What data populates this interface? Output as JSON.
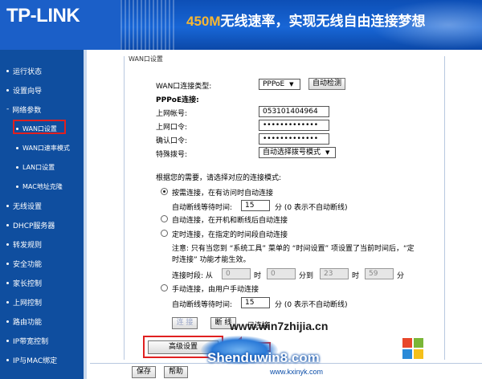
{
  "header": {
    "logo": "TP-LINK",
    "slogan_highlight": "450M",
    "slogan_rest": "无线速率，实现无线自由连接梦想"
  },
  "sidebar": {
    "items": [
      {
        "label": "运行状态",
        "level": "top"
      },
      {
        "label": "设置向导",
        "level": "top"
      },
      {
        "label": "网络参数",
        "level": "group"
      },
      {
        "label": "WAN口设置",
        "level": "sub",
        "selected": true
      },
      {
        "label": "WAN口速率模式",
        "level": "sub"
      },
      {
        "label": "LAN口设置",
        "level": "sub"
      },
      {
        "label": "MAC地址克隆",
        "level": "sub"
      },
      {
        "label": "无线设置",
        "level": "top"
      },
      {
        "label": "DHCP服务器",
        "level": "top"
      },
      {
        "label": "转发规则",
        "level": "top"
      },
      {
        "label": "安全功能",
        "level": "top"
      },
      {
        "label": "家长控制",
        "level": "top"
      },
      {
        "label": "上网控制",
        "level": "top"
      },
      {
        "label": "路由功能",
        "level": "top"
      },
      {
        "label": "IP带宽控制",
        "level": "top"
      },
      {
        "label": "IP与MAC绑定",
        "level": "top"
      }
    ]
  },
  "form": {
    "title": "WAN口设置",
    "conn_type_label": "WAN口连接类型:",
    "conn_type_value": "PPPoE",
    "auto_detect": "自动检测",
    "pppoe_heading": "PPPoE连接:",
    "account_label": "上网帐号:",
    "account_value": "053101404964",
    "password_label": "上网口令:",
    "password_value": "•••••••••••••",
    "confirm_label": "确认口令:",
    "confirm_value": "•••••••••••••",
    "dial_label": "特殊拨号:",
    "dial_value": "自动选择拨号模式",
    "mode_prompt": "根据您的需要，请选择对应的连接模式:",
    "mode_on_demand": "按需连接，在有访问时自动连接",
    "idle_label_1": "自动断线等待时间:",
    "idle_value_1": "15",
    "idle_hint_1": "分 (0 表示不自动断线)",
    "mode_auto": "自动连接，在开机和断线后自动连接",
    "mode_timed": "定时连接，在指定的时间段自动连接",
    "note_line1": "注意: 只有当您到 “系统工具” 菜单的 “时间设置” 项设置了当前时间后，“定",
    "note_line2": "时连接” 功能才能生效。",
    "period_label": "连接时段: 从",
    "t_from_h": "0",
    "t_hour1": "时",
    "t_from_m": "0",
    "t_min_to": "分到",
    "t_to_h": "23",
    "t_hour2": "时",
    "t_to_m": "59",
    "t_min2": "分",
    "mode_manual": "手动连接，由用户手动连接",
    "idle_label_2": "自动断线等待时间:",
    "idle_value_2": "15",
    "idle_hint_2": "分 (0 表示不自动断线)",
    "connect_btn": "连 接",
    "disconnect_btn": "断 线",
    "status": "已连接",
    "advanced_btn": "高级设置"
  },
  "footer": {
    "save": "保存",
    "help": "帮助"
  },
  "watermark": {
    "site_top": "www.win7zhijia.cn",
    "site_main": "Shenduwin8.com",
    "site_bottom": "www.kxinyk.com"
  },
  "colors": {
    "sidebar_bg": "#0f4e9f",
    "header_bg": "#1866d6",
    "highlight_red": "#e02020",
    "slogan_accent": "#f7b733"
  }
}
